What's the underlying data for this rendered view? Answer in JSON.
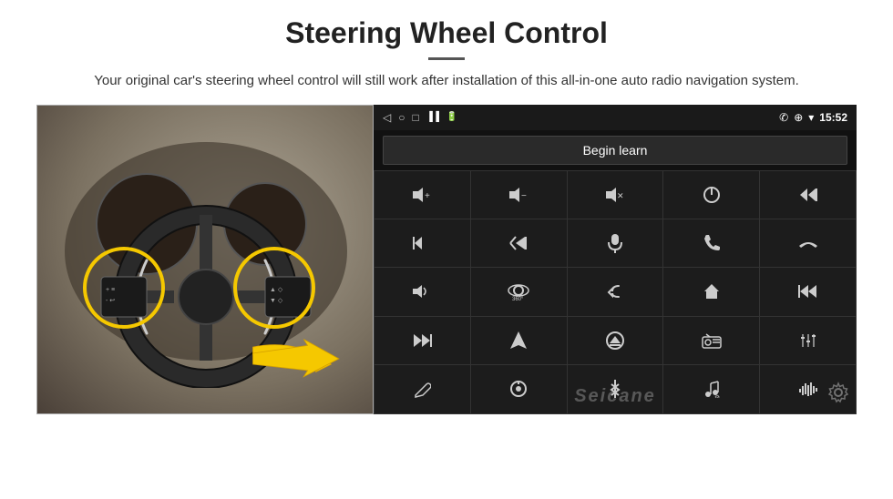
{
  "page": {
    "title": "Steering Wheel Control",
    "subtitle": "Your original car's steering wheel control will still work after installation of this all-in-one auto radio navigation system.",
    "divider": true
  },
  "status_bar": {
    "time": "15:52",
    "nav_icons": [
      "◁",
      "○",
      "□"
    ],
    "right_icons": [
      "☎",
      "⊕",
      "▾"
    ]
  },
  "begin_learn": {
    "label": "Begin learn"
  },
  "controls": [
    {
      "icon": "🔊+",
      "row": 1,
      "col": 1
    },
    {
      "icon": "🔊−",
      "row": 1,
      "col": 2
    },
    {
      "icon": "🔇",
      "row": 1,
      "col": 3
    },
    {
      "icon": "⏻",
      "row": 1,
      "col": 4
    },
    {
      "icon": "⏮",
      "row": 1,
      "col": 5
    },
    {
      "icon": "⏭",
      "row": 2,
      "col": 1
    },
    {
      "icon": "⏭",
      "row": 2,
      "col": 2
    },
    {
      "icon": "🎤",
      "row": 2,
      "col": 3
    },
    {
      "icon": "📞",
      "row": 2,
      "col": 4
    },
    {
      "icon": "↩",
      "row": 2,
      "col": 5
    },
    {
      "icon": "📣",
      "row": 3,
      "col": 1
    },
    {
      "icon": "360°",
      "row": 3,
      "col": 2
    },
    {
      "icon": "↺",
      "row": 3,
      "col": 3
    },
    {
      "icon": "⌂",
      "row": 3,
      "col": 4
    },
    {
      "icon": "⏮⏮",
      "row": 3,
      "col": 5
    },
    {
      "icon": "⏭⏭",
      "row": 4,
      "col": 1
    },
    {
      "icon": "▶",
      "row": 4,
      "col": 2
    },
    {
      "icon": "⏺",
      "row": 4,
      "col": 3
    },
    {
      "icon": "📻",
      "row": 4,
      "col": 4
    },
    {
      "icon": "⚙",
      "row": 4,
      "col": 5
    },
    {
      "icon": "✏",
      "row": 5,
      "col": 1
    },
    {
      "icon": "◎",
      "row": 5,
      "col": 2
    },
    {
      "icon": "✱",
      "row": 5,
      "col": 3
    },
    {
      "icon": "🎵",
      "row": 5,
      "col": 4
    },
    {
      "icon": "|||",
      "row": 5,
      "col": 5
    }
  ],
  "watermark": "Seicane",
  "icons": {
    "back": "◁",
    "home": "○",
    "recents": "□",
    "phone": "✆",
    "location": "⊕",
    "wifi": "▾",
    "gear": "⚙"
  }
}
